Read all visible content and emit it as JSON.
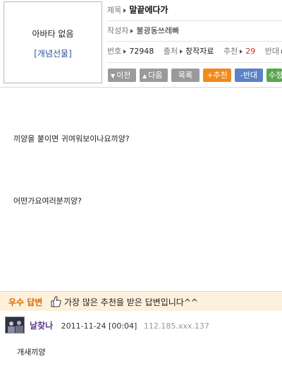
{
  "profile": {
    "no_avatar": "아바타 없음",
    "gift_link": "[개념선물]"
  },
  "post": {
    "title_label": "제목",
    "title": "말끝에다가",
    "author_label": "작성자",
    "author": "불광동쓰레빠",
    "number_label": "번호",
    "number": "72948",
    "source_label": "출처",
    "source": "창작자료",
    "recommend_label": "추천",
    "recommend_count": "29",
    "oppose_label": "반대"
  },
  "buttons": {
    "prev": "이전",
    "next": "다음",
    "list": "목록",
    "recommend": "+추천",
    "oppose": "-반대",
    "edit": "수정"
  },
  "content": {
    "line1": "끼양을 붙이면 귀여워보이나요끼양?",
    "line2": "어떤가요여러분끼양?"
  },
  "best_answer": {
    "label": "우수 답변",
    "text": "가장 많은 추천을 받은 답변입니다^^"
  },
  "answer": {
    "nickname": "날찾나",
    "date": "2011-11-24 [00:04]",
    "ip": "112.185.xxx.137",
    "body": "개새끼양"
  },
  "colors": {
    "recommend_btn": "#f08a1c",
    "oppose_btn": "#5b82c8",
    "edit_btn": "#59a84b",
    "best_bar": "#fdf0dc"
  }
}
